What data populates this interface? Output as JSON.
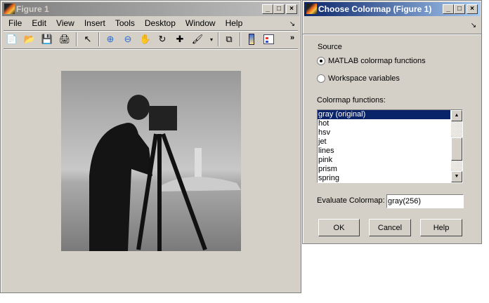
{
  "figure": {
    "title": "Figure 1",
    "menu": [
      "File",
      "Edit",
      "View",
      "Insert",
      "Tools",
      "Desktop",
      "Window",
      "Help"
    ],
    "toolbar": [
      "new-file",
      "open",
      "save",
      "print",
      "select-arrow",
      "zoom-in",
      "zoom-out",
      "pan-hand",
      "rotate-3d",
      "data-cursor",
      "brush",
      "link-plot",
      "colorbar",
      "legend"
    ]
  },
  "dialog": {
    "title": "Choose Colormap (Figure 1)",
    "source_label": "Source",
    "radio1": "MATLAB colormap functions",
    "radio2": "Workspace variables",
    "functions_label": "Colormap functions:",
    "functions": [
      "gray (original)",
      "hot",
      "hsv",
      "jet",
      "lines",
      "pink",
      "prism",
      "spring"
    ],
    "evaluate_label": "Evaluate Colormap:",
    "evaluate_value": "gray(256)",
    "ok": "OK",
    "cancel": "Cancel",
    "help": "Help"
  }
}
